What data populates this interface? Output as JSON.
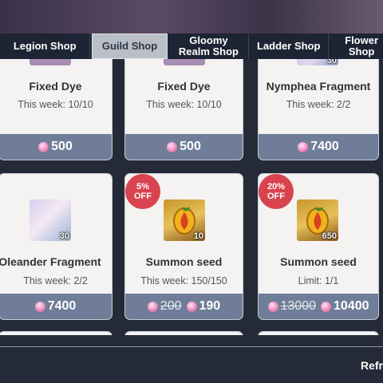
{
  "tabs": [
    {
      "label": "Legion Shop"
    },
    {
      "label": "Guild Shop"
    },
    {
      "label": "Gloomy Realm Shop"
    },
    {
      "label": "Ladder Shop"
    },
    {
      "label": "Flower Shop"
    }
  ],
  "active_tab": "Guild Shop",
  "items": [
    {
      "name": "Fixed Dye",
      "limit": "This week: 10/10",
      "price": "500",
      "icon": "dye-icon"
    },
    {
      "name": "Fixed Dye",
      "limit": "This week: 10/10",
      "price": "500",
      "icon": "dye-icon"
    },
    {
      "name": "Nymphea Fragment",
      "limit": "This week: 2/2",
      "price": "7400",
      "icon": "portrait-icon",
      "count": "30"
    },
    {
      "name": "Oleander Fragment",
      "limit": "This week: 2/2",
      "price": "7400",
      "icon": "portrait-icon",
      "count": "30"
    },
    {
      "name": "Summon seed",
      "limit": "This week: 150/150",
      "old_price": "200",
      "price": "190",
      "discount": "5%",
      "discount_suffix": "OFF",
      "icon": "seed-icon",
      "count": "10"
    },
    {
      "name": "Summon seed",
      "limit": "Limit: 1/1",
      "old_price": "13000",
      "price": "10400",
      "discount": "20%",
      "discount_suffix": "OFF",
      "icon": "seed-icon",
      "count": "650"
    }
  ],
  "refresh_label": "Refr",
  "colors": {
    "tab_bar": "#1d2433",
    "active_tab": "#b9bec7",
    "price_bar": "#6f7d98",
    "discount_badge": "#d8434f",
    "gem": "#f49ac8"
  }
}
